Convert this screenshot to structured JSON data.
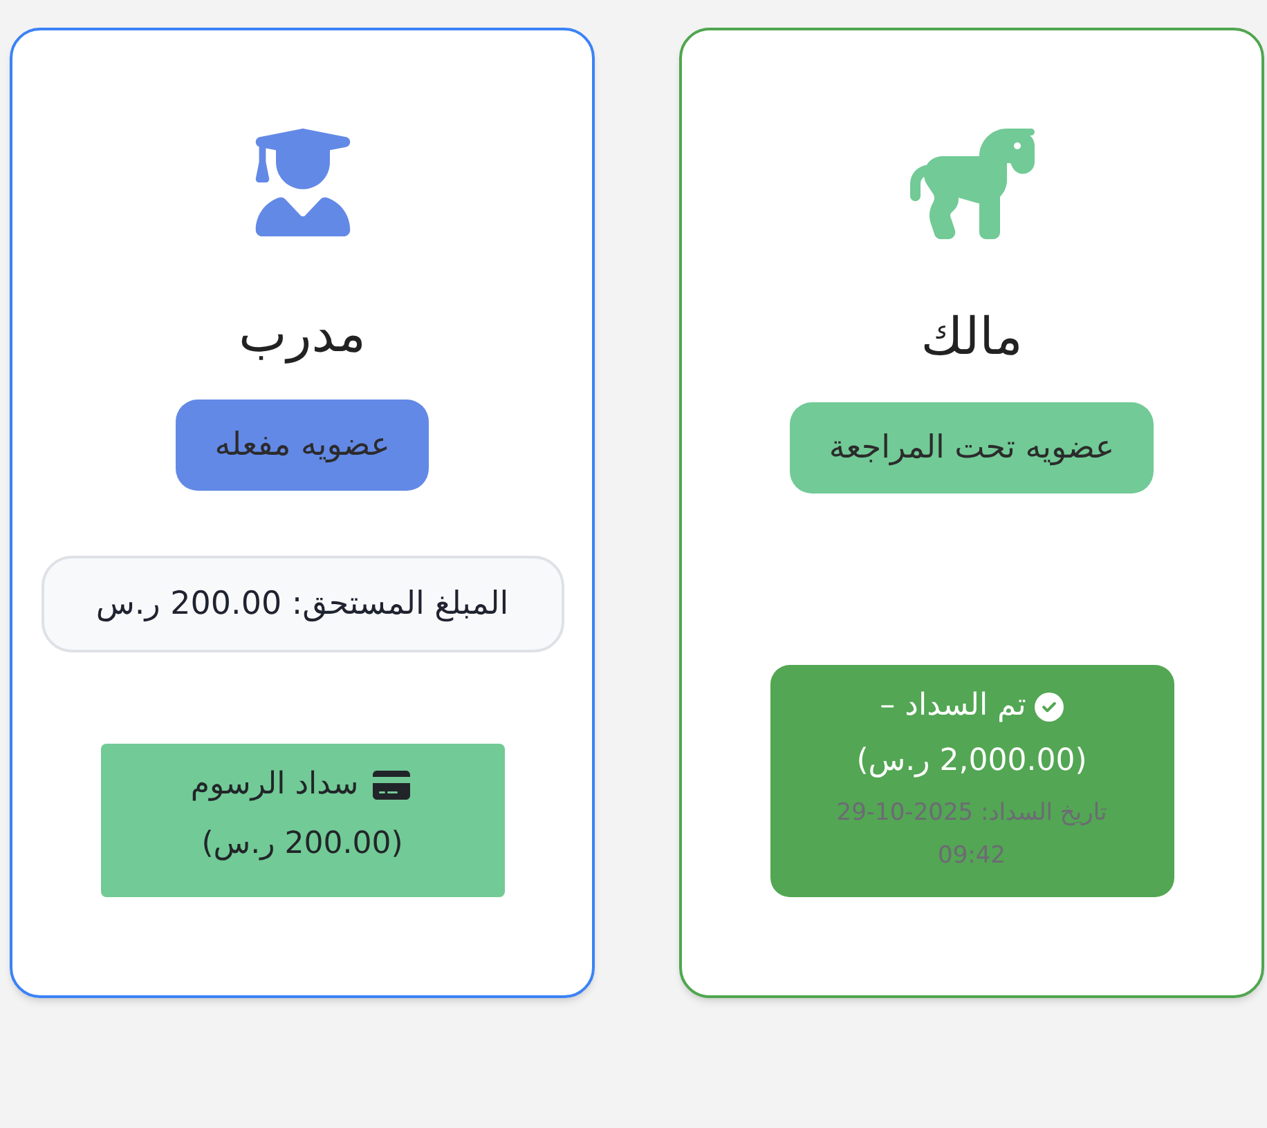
{
  "cards": [
    {
      "kind": "owner",
      "title": "مالك",
      "badge": "عضويه تحت المراجعة",
      "payment": {
        "kind": "paid",
        "status": "تم السداد –",
        "amount": "(2,000.00 ر.س)",
        "date": "تاريخ السداد: 2025-10-29 09:42"
      }
    },
    {
      "kind": "trainer",
      "title": "مدرب",
      "badge": "عضويه مفعله",
      "amount_due": "المبلغ المستحق: 200.00 ر.س",
      "payment": {
        "kind": "pay_button",
        "label": "سداد الرسوم",
        "amount": "(200.00 ر.س)"
      }
    }
  ]
}
